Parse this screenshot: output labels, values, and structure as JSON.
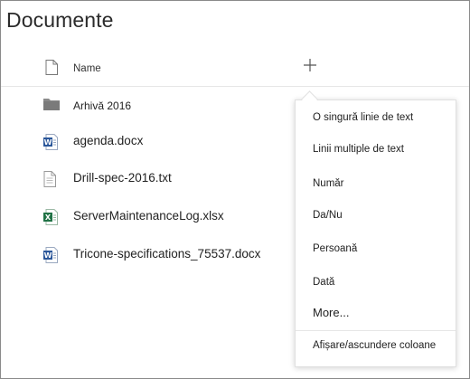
{
  "page": {
    "title": "Documente"
  },
  "header": {
    "name_label": "Name"
  },
  "files": [
    {
      "name": "Arhivă 2016",
      "icon": "folder-icon"
    },
    {
      "name": "agenda.docx",
      "icon": "word-file-icon"
    },
    {
      "name": "Drill-spec-2016.txt",
      "icon": "text-file-icon"
    },
    {
      "name": "ServerMaintenanceLog.xlsx",
      "icon": "excel-file-icon"
    },
    {
      "name": "Tricone-specifications_75537.docx",
      "icon": "word-file-icon"
    }
  ],
  "menu": {
    "items": [
      "O singură linie de text",
      "Linii multiple de text",
      "Număr",
      "Da/Nu",
      "Persoană",
      "Dată",
      "More...",
      "Afișare/ascundere coloane"
    ]
  },
  "colors": {
    "word": "#2b579a",
    "excel": "#217346",
    "folder": "#8a8a8a",
    "border": "#8a8a8a"
  }
}
